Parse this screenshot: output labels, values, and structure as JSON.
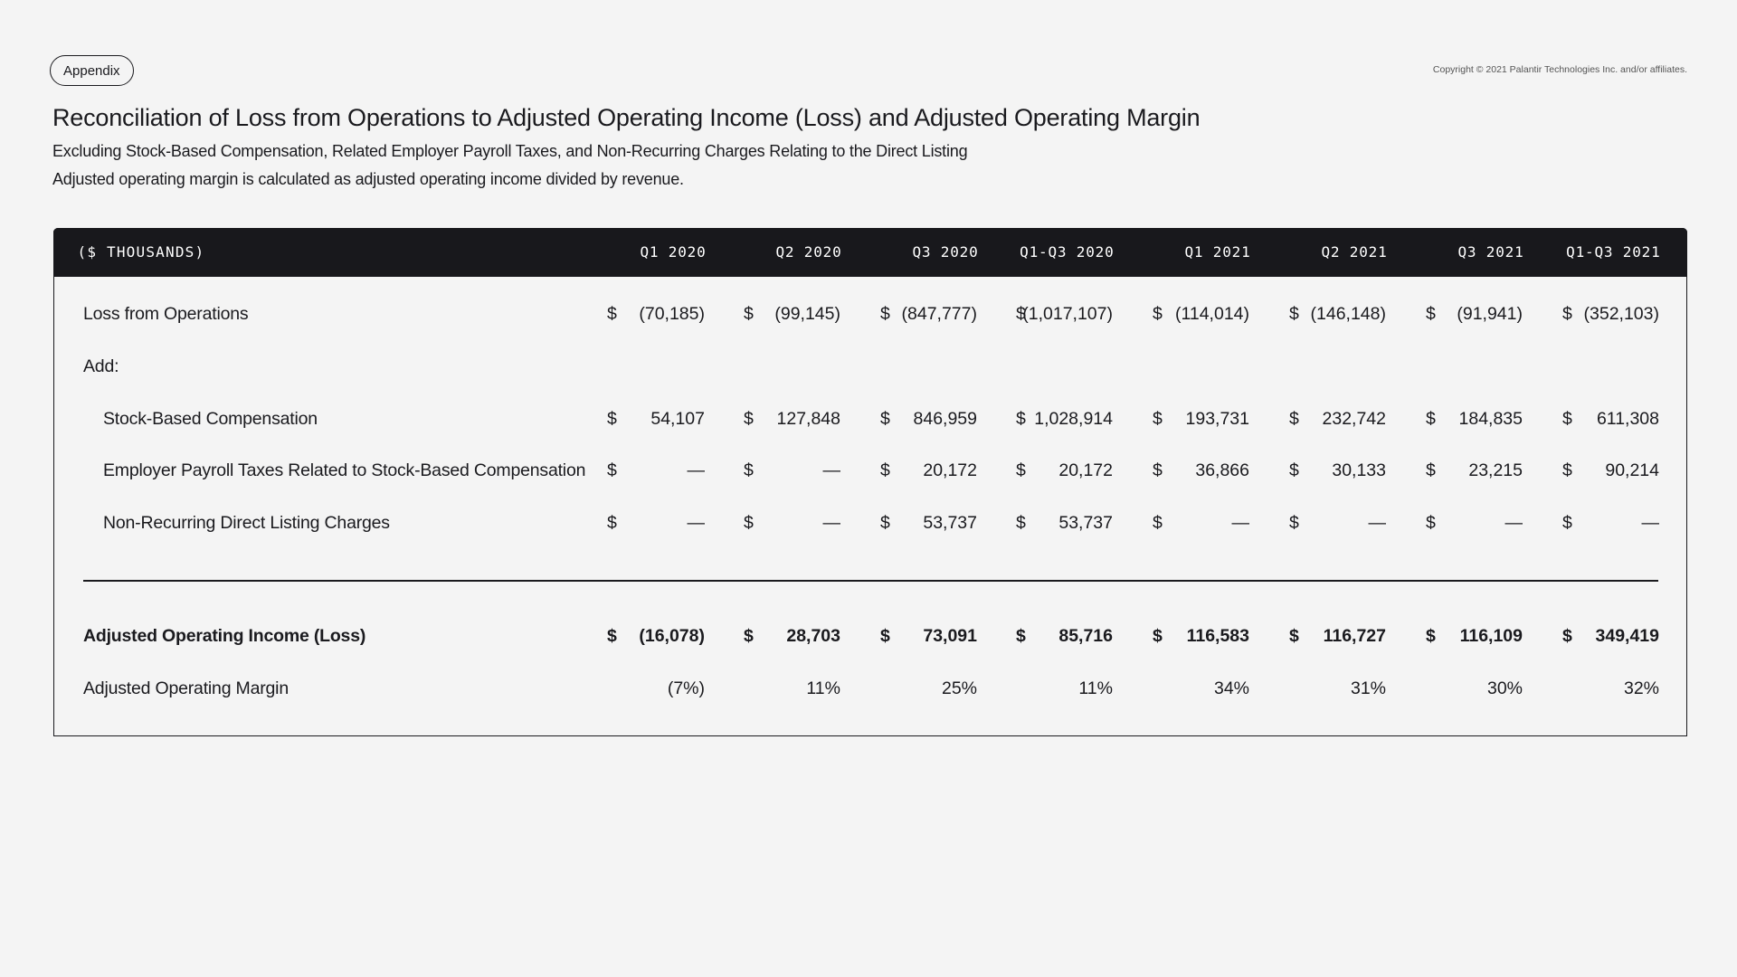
{
  "badge": "Appendix",
  "copyright": "Copyright © 2021 Palantir Technologies Inc. and/or affiliates.",
  "title": "Reconciliation of Loss from Operations to Adjusted Operating Income (Loss) and Adjusted Operating Margin",
  "subtitle_1": "Excluding Stock-Based Compensation, Related Employer Payroll Taxes, and Non-Recurring Charges Relating to the Direct Listing",
  "subtitle_2": "Adjusted operating margin is calculated as adjusted operating income divided by revenue.",
  "table": {
    "unit_label": "($ THOUSANDS)",
    "columns": [
      "Q1 2020",
      "Q2 2020",
      "Q3 2020",
      "Q1-Q3 2020",
      "Q1 2021",
      "Q2 2021",
      "Q3 2021",
      "Q1-Q3 2021"
    ],
    "currency_symbol": "$",
    "rows": [
      {
        "label": "Loss from Operations",
        "indent": false,
        "bold": false,
        "currency": true,
        "values": [
          "(70,185)",
          "(99,145)",
          "(847,777)",
          "(1,017,107)",
          "(114,014)",
          "(146,148)",
          "(91,941)",
          "(352,103)"
        ]
      },
      {
        "label": "Add:",
        "indent": false,
        "bold": false,
        "currency": false,
        "values": []
      },
      {
        "label": "Stock-Based Compensation",
        "indent": true,
        "bold": false,
        "currency": true,
        "values": [
          "54,107",
          "127,848",
          "846,959",
          "1,028,914",
          "193,731",
          "232,742",
          "184,835",
          "611,308"
        ]
      },
      {
        "label": "Employer Payroll Taxes Related to Stock-Based Compensation",
        "indent": true,
        "bold": false,
        "currency": true,
        "values": [
          "—",
          "—",
          "20,172",
          "20,172",
          "36,866",
          "30,133",
          "23,215",
          "90,214"
        ]
      },
      {
        "label": "Non-Recurring Direct Listing Charges",
        "indent": true,
        "bold": false,
        "currency": true,
        "values": [
          "—",
          "—",
          "53,737",
          "53,737",
          "—",
          "—",
          "—",
          "—"
        ]
      },
      {
        "label": "Adjusted Operating Income (Loss)",
        "indent": false,
        "bold": true,
        "currency": true,
        "values": [
          "(16,078)",
          "28,703",
          "73,091",
          "85,716",
          "116,583",
          "116,727",
          "116,109",
          "349,419"
        ]
      },
      {
        "label": "Adjusted Operating Margin",
        "indent": false,
        "bold": false,
        "currency": false,
        "values": [
          "(7%)",
          "11%",
          "25%",
          "11%",
          "34%",
          "31%",
          "30%",
          "32%"
        ]
      }
    ]
  }
}
